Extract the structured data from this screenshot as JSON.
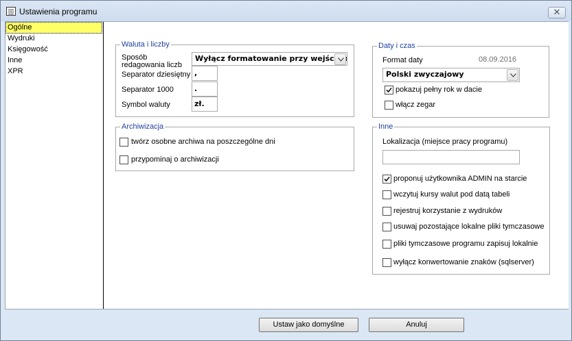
{
  "window": {
    "title": "Ustawienia programu",
    "close_symbol": "✕",
    "icon": "settings-app-icon"
  },
  "sidebar": {
    "items": [
      {
        "label": "Ogólne",
        "selected": true
      },
      {
        "label": "Wydruki",
        "selected": false
      },
      {
        "label": "Księgowość",
        "selected": false
      },
      {
        "label": "Inne",
        "selected": false
      },
      {
        "label": "XPR",
        "selected": false
      }
    ]
  },
  "currency": {
    "group_title": "Waluta i liczby",
    "edit_mode_label": "Sposób redagowania liczb",
    "edit_mode_value": "Wyłącz formatowanie przy wejściu do",
    "decimal_sep_label": "Separator dziesiętny",
    "decimal_sep_value": ",",
    "thousand_sep_label": "Separator 1000",
    "thousand_sep_value": ".",
    "currency_symbol_label": "Symbol waluty",
    "currency_symbol_value": "zł."
  },
  "archive": {
    "group_title": "Archiwizacja",
    "options": [
      {
        "label": "twórz osobne archiwa na poszczególne dni",
        "checked": false
      },
      {
        "label": "przypominaj o archiwizacji",
        "checked": false
      }
    ]
  },
  "datetime": {
    "group_title": "Daty i czas",
    "date_format_label": "Format daty",
    "date_preview": "08.09.2016",
    "date_format_value": "Polski zwyczajowy",
    "options": [
      {
        "label": "pokazuj pełny rok w dacie",
        "checked": true
      },
      {
        "label": "włącz zegar",
        "checked": false
      }
    ]
  },
  "other": {
    "group_title": "Inne",
    "location_label": "Lokalizacja (miejsce pracy programu)",
    "location_value": "",
    "options": [
      {
        "label": "proponuj użytkownika ADMIN na starcie",
        "checked": true
      },
      {
        "label": "wczytuj kursy walut pod datą tabeli",
        "checked": false
      },
      {
        "label": "rejestruj korzystanie z wydruków",
        "checked": false
      },
      {
        "label": "usuwaj pozostające lokalne pliki tymczasowe",
        "checked": false
      },
      {
        "label": "pliki tymczasowe programu zapisuj lokalnie",
        "checked": false
      },
      {
        "label": "wyłącz konwertowanie znaków (sqlserver)",
        "checked": false
      }
    ]
  },
  "footer": {
    "default_button": "Ustaw jako domyślne",
    "cancel_button": "Anuluj"
  }
}
